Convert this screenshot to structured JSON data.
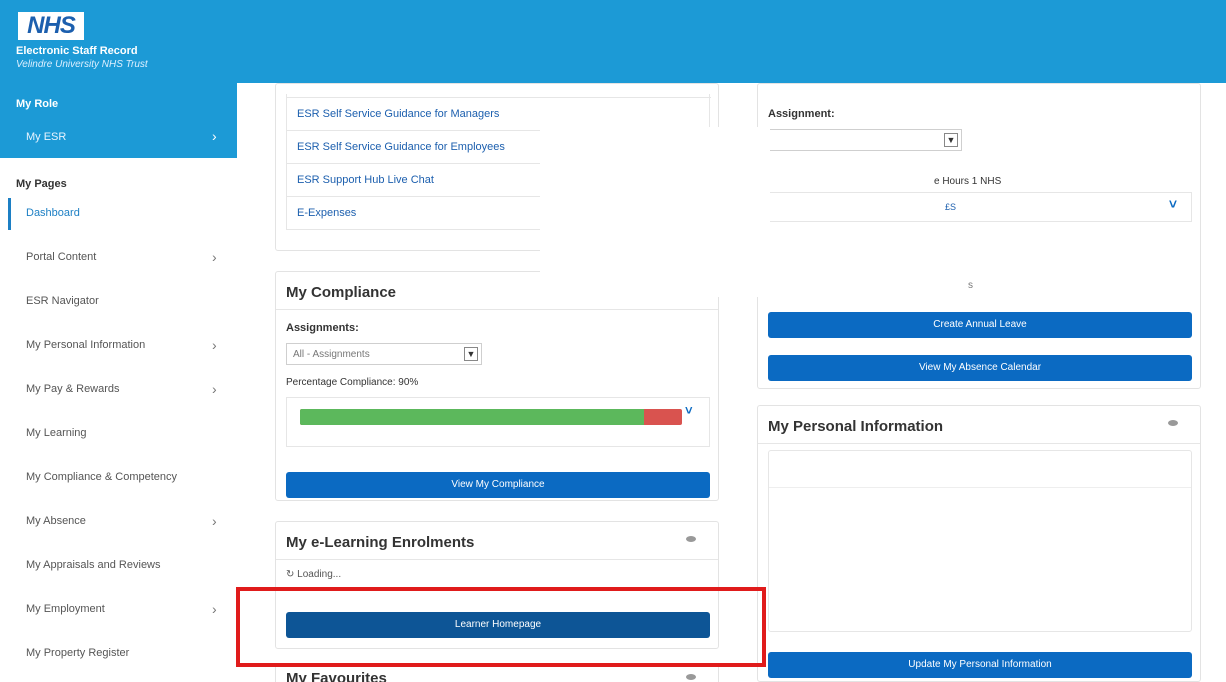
{
  "header": {
    "logo": "NHS",
    "title": "Electronic Staff Record",
    "subtitle": "Velindre University NHS Trust"
  },
  "sidebar": {
    "role_title": "My Role",
    "role_item": "My ESR",
    "pages_title": "My Pages",
    "items": [
      {
        "label": "Dashboard"
      },
      {
        "label": "Portal Content"
      },
      {
        "label": "ESR Navigator"
      },
      {
        "label": "My Personal Information"
      },
      {
        "label": "My Pay & Rewards"
      },
      {
        "label": "My Learning"
      },
      {
        "label": "My Compliance & Competency"
      },
      {
        "label": "My Absence"
      },
      {
        "label": "My Appraisals and Reviews"
      },
      {
        "label": "My Employment"
      },
      {
        "label": "My Property Register"
      }
    ]
  },
  "links_panel": {
    "links": [
      "ESR Self Service Guidance for Managers",
      "ESR Self Service Guidance for Employees",
      "ESR Support Hub Live Chat",
      "E-Expenses"
    ]
  },
  "compliance": {
    "title": "My Compliance",
    "assignments_label": "Assignments:",
    "assignments_value": "All - Assignments",
    "percentage_label": "Percentage Compliance: 90%",
    "compliance_fraction": 0.9,
    "button": "View My Compliance",
    "colors": {
      "green": "#5cb85c",
      "red": "#d9534f"
    }
  },
  "elearning": {
    "title": "My e-Learning Enrolments",
    "loading": "Loading...",
    "button": "Learner Homepage"
  },
  "favourites": {
    "title": "My Favourites"
  },
  "absence": {
    "assignment_label": "Assignment:",
    "hours_text": "e Hours 1 NHS",
    "partial_value": "£S",
    "partial_s": "s",
    "create_button": "Create Annual Leave",
    "calendar_button": "View My Absence Calendar"
  },
  "personal_info": {
    "title": "My Personal Information",
    "button": "Update My Personal Information"
  }
}
